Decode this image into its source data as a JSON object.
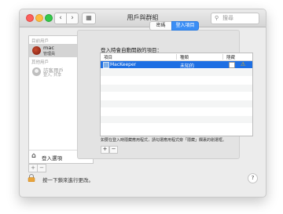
{
  "window": {
    "title": "用戶與群組"
  },
  "toolbar": {
    "back_glyph": "‹",
    "forward_glyph": "›",
    "grid_glyph": "▦",
    "search_placeholder": "搜尋",
    "search_icon": "magnifier-icon"
  },
  "sidebar": {
    "current_users_label": "目前用戶",
    "other_users_label": "其他用戶",
    "users": [
      {
        "name": "mac",
        "role": "管理員",
        "selected": true
      },
      {
        "name": "訪客用戶",
        "role": "登入, 共享",
        "selected": false
      }
    ],
    "login_options_label": "登入選項",
    "add_glyph": "+",
    "remove_glyph": "−"
  },
  "content": {
    "tabs": [
      {
        "label": "密碼",
        "active": false
      },
      {
        "label": "登入項目",
        "active": true
      }
    ],
    "heading": "登入時會自動開啟的項目：",
    "table": {
      "columns": [
        "項目",
        "種類",
        "隱藏"
      ],
      "rows": [
        {
          "item": "MacKeeper",
          "kind": "未知的",
          "hidden": false,
          "warning": true,
          "selected": true
        }
      ]
    },
    "hint": "如要在登入時隱藏應用程式，請勾選應用程式旁「隱藏」欄裏的剔選框。",
    "add_glyph": "+",
    "remove_glyph": "−"
  },
  "footer": {
    "lock_text": "按一下鎖來進行更改。",
    "help_glyph": "?"
  },
  "colors": {
    "selection": "#1e6fe3",
    "tab_active": "#3b8ef5",
    "warning": "#f3b400"
  }
}
